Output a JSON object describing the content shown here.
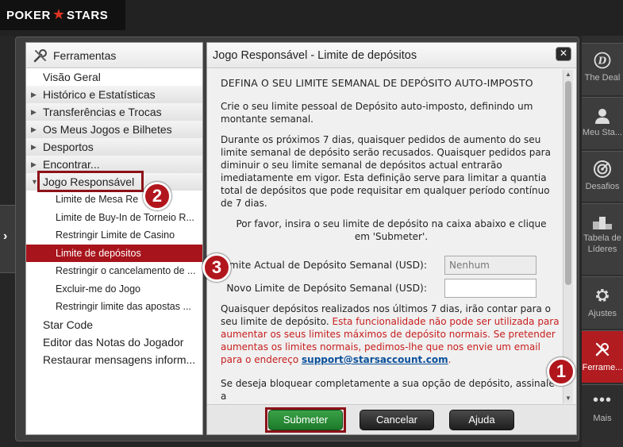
{
  "brand": {
    "name_left": "POKER",
    "name_right": "STARS"
  },
  "left_panel": {
    "title": "Ferramentas",
    "items": [
      {
        "label": "Visão Geral",
        "arrow": ""
      },
      {
        "label": "Histórico e Estatísticas",
        "arrow": "▶"
      },
      {
        "label": "Transferências e Trocas",
        "arrow": "▶"
      },
      {
        "label": "Os Meus Jogos e Bilhetes",
        "arrow": "▶"
      },
      {
        "label": "Desportos",
        "arrow": "▶"
      },
      {
        "label": "Encontrar...",
        "arrow": "▶"
      },
      {
        "label": "Jogo Responsável",
        "arrow": "▼"
      }
    ],
    "subitems": [
      "Limite de Mesa Re",
      "Limite de Buy-In de Torneio R...",
      "Restringir Limite de Casino",
      "Limite de depósitos",
      "Restringir o cancelamento de ...",
      "Excluir-me do Jogo",
      "Restringir limite das apostas ..."
    ],
    "bottom_items": [
      "Star Code",
      "Editor das Notas do Jogador",
      "Restaurar mensagens inform..."
    ]
  },
  "right_panel": {
    "title": "Jogo Responsável - Limite de depósitos",
    "heading": "DEFINA O SEU LIMITE SEMANAL DE DEPÓSITO AUTO-IMPOSTO",
    "para1": "Crie o seu limite pessoal de Depósito auto-imposto, definindo um montante semanal.",
    "para2": "Durante os próximos 7 dias, quaisquer pedidos de aumento do seu limite semanal de depósito serão recusados. Quaisquer pedidos para diminuir o seu limite semanal de depósitos actual entrarão imediatamente em vigor. Esta definição serve para limitar a quantia total de depósitos que pode requisitar em qualquer período contínuo de 7 dias.",
    "para3": "Por favor, insira o seu limite de depósito na caixa abaixo e clique em 'Submeter'.",
    "current_label": "Limite Actual de Depósito Semanal (USD):",
    "current_value": "Nenhum",
    "new_label": "Novo Limite de Depósito Semanal (USD):",
    "new_value": "",
    "para4_black": "Quaisquer depósitos realizados nos últimos 7 dias, irão contar para o seu limite de depósito. ",
    "para4_red": "Esta funcionalidade não pode ser utilizada para aumentar os seus limites máximos de depósito normais. Se pretender aumentas os limites normais, pedimos-lhe que nos envie um email para o endereço ",
    "email": "support@starsaccount.com",
    "para4_end": ".",
    "para5": "Se deseja bloquear completamente a sua opção de depósito, assinale a"
  },
  "buttons": {
    "submit": "Submeter",
    "cancel": "Cancelar",
    "help": "Ajuda"
  },
  "close_glyph": "✕",
  "sidebar": [
    {
      "label": "The Deal",
      "icon": "deal-icon"
    },
    {
      "label": "Meu Sta...",
      "icon": "user-icon"
    },
    {
      "label": "Desafios",
      "icon": "target-icon"
    },
    {
      "label": "Tabela de Líderes",
      "icon": "podium-icon"
    },
    {
      "label": "Ajustes",
      "icon": "gear-icon"
    },
    {
      "label": "Ferrame...",
      "icon": "tools-icon"
    },
    {
      "label": "Mais",
      "icon": "more-icon"
    }
  ],
  "badges": [
    "1",
    "2",
    "3"
  ],
  "colors": {
    "accent": "#b11c20",
    "submit": "#2a8e37"
  }
}
